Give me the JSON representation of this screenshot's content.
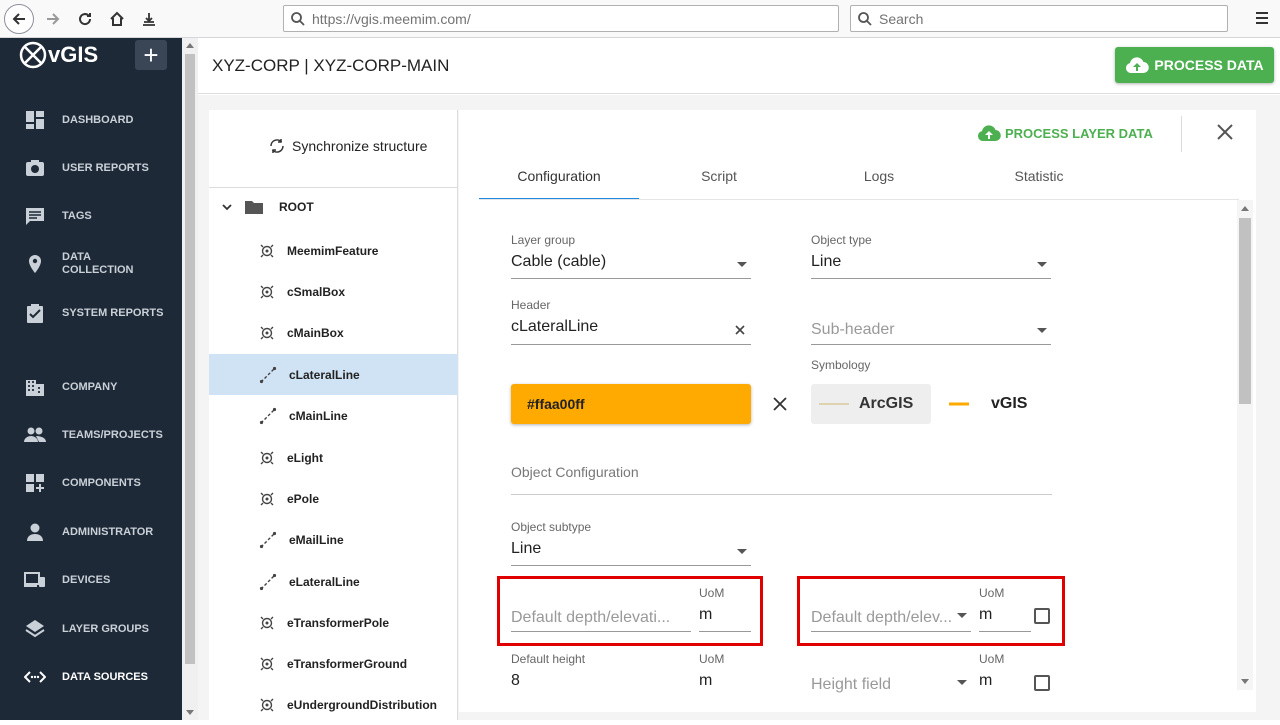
{
  "browser": {
    "url": "https://vgis.meemim.com/",
    "search_placeholder": "Search"
  },
  "sidebar": {
    "logo": "vGIS",
    "add_label": "+",
    "items": [
      {
        "label": "DASHBOARD",
        "icon": "dashboard-icon"
      },
      {
        "label": "USER REPORTS",
        "icon": "camera-icon"
      },
      {
        "label": "TAGS",
        "icon": "comment-icon"
      },
      {
        "label": "DATA COLLECTION",
        "icon": "location-pin-icon"
      },
      {
        "label": "SYSTEM REPORTS",
        "icon": "clipboard-check-icon"
      },
      {
        "label": "COMPANY",
        "icon": "building-icon"
      },
      {
        "label": "TEAMS/PROJECTS",
        "icon": "people-icon"
      },
      {
        "label": "COMPONENTS",
        "icon": "widgets-add-icon"
      },
      {
        "label": "ADMINISTRATOR",
        "icon": "person-icon"
      },
      {
        "label": "DEVICES",
        "icon": "devices-icon"
      },
      {
        "label": "LAYER GROUPS",
        "icon": "layers-icon"
      },
      {
        "label": "DATA SOURCES",
        "icon": "code-arrows-icon",
        "active": true
      }
    ]
  },
  "header": {
    "title": "XYZ-CORP | XYZ-CORP-MAIN",
    "process_button": "PROCESS DATA"
  },
  "tree": {
    "sync_label": "Synchronize structure",
    "root_label": "ROOT",
    "items": [
      {
        "label": "MeemimFeature",
        "type": "point"
      },
      {
        "label": "cSmalBox",
        "type": "point"
      },
      {
        "label": "cMainBox",
        "type": "point"
      },
      {
        "label": "cLateralLine",
        "type": "line",
        "selected": true
      },
      {
        "label": "cMainLine",
        "type": "line"
      },
      {
        "label": "eLight",
        "type": "point"
      },
      {
        "label": "ePole",
        "type": "point"
      },
      {
        "label": "eMailLine",
        "type": "line"
      },
      {
        "label": "eLateralLine",
        "type": "line"
      },
      {
        "label": "eTransformerPole",
        "type": "point"
      },
      {
        "label": "eTransformerGround",
        "type": "point"
      },
      {
        "label": "eUndergroundDistribution",
        "type": "point"
      }
    ]
  },
  "detail": {
    "process_layer_button": "PROCESS LAYER DATA",
    "tabs": [
      "Configuration",
      "Script",
      "Logs",
      "Statistic"
    ],
    "active_tab": "Configuration",
    "layer_group": {
      "label": "Layer group",
      "value": "Cable (cable)"
    },
    "object_type": {
      "label": "Object type",
      "value": "Line"
    },
    "header_field": {
      "label": "Header",
      "value": "cLateralLine"
    },
    "sub_header": {
      "placeholder": "Sub-header"
    },
    "symbology_label": "Symbology",
    "color_value": "#ffaa00ff",
    "arcgis_label": "ArcGIS",
    "vgis_label": "vGIS",
    "object_configuration": "Object Configuration",
    "object_subtype": {
      "label": "Object subtype",
      "value": "Line"
    },
    "depth_left": {
      "placeholder": "Default depth/elevati...",
      "uom_label": "UoM",
      "uom_value": "m"
    },
    "depth_right": {
      "placeholder": "Default depth/elev...",
      "uom_label": "UoM",
      "uom_value": "m"
    },
    "height_left": {
      "label": "Default height",
      "value": "8",
      "uom_label": "UoM",
      "uom_value": "m"
    },
    "height_right": {
      "placeholder": "Height field",
      "uom_label": "UoM",
      "uom_value": "m"
    }
  },
  "colors": {
    "sidebar_bg": "#1e2937",
    "accent_green": "#4caf50",
    "symbology_orange": "#ffaa00",
    "tab_underline": "#1e88e5",
    "highlight_red": "#e00000",
    "selected_row": "#d0e3f5"
  }
}
